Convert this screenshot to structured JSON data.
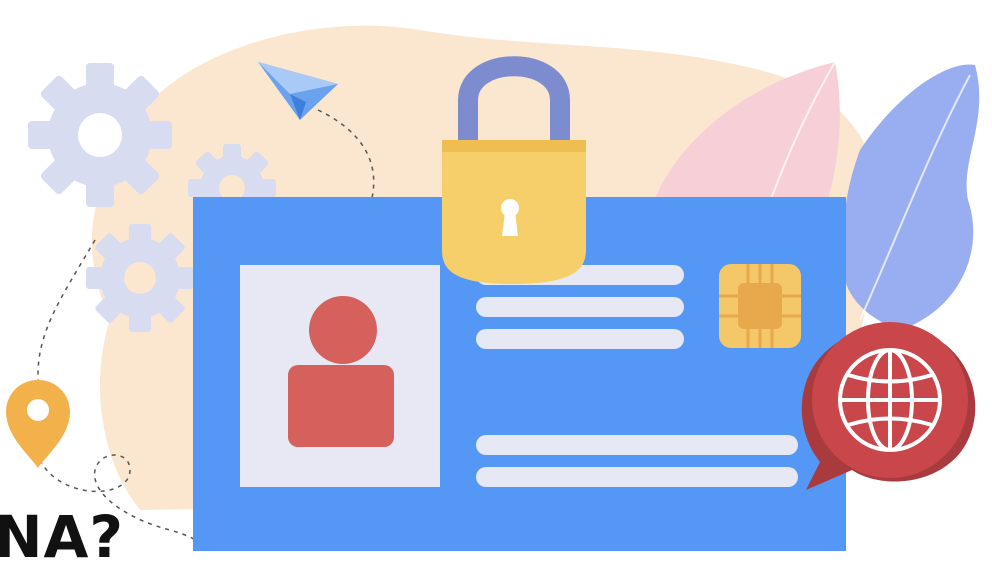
{
  "caption": {
    "text": "NA?"
  },
  "colors": {
    "blob": "#fbe6cf",
    "card": "#5597f5",
    "photo_bg": "#e8e8f4",
    "person": "#d5605c",
    "text_line": "#e6e8f4",
    "chip": "#f4c868",
    "lock_shackle": "#7d8bcf",
    "lock_body": "#f6cf6b",
    "globe_bubble": "#c9474a",
    "pin": "#f2b14b",
    "gear": "#d7dcf1",
    "plane": "#6aa2ee",
    "leaf_pink": "#f7cfd6",
    "leaf_blue": "#99aef0"
  },
  "icons": [
    "gear-icon",
    "paper-plane-icon",
    "padlock-icon",
    "chip-icon",
    "globe-icon",
    "location-pin-icon",
    "person-icon"
  ]
}
